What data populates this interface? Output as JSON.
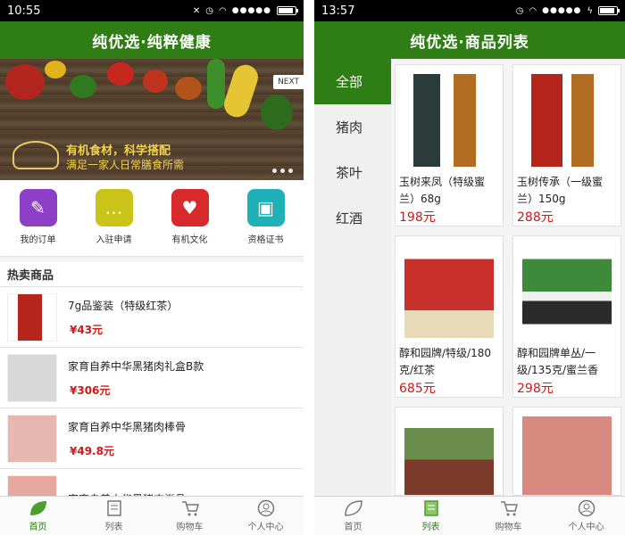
{
  "left": {
    "status": {
      "time": "10:55"
    },
    "header": {
      "title": "纯优选·纯粹健康"
    },
    "banner": {
      "next_label": "NEXT",
      "line1": "有机食材，科学搭配",
      "line2": "满足一家人日常膳食所需"
    },
    "quick": [
      {
        "label": "我的订单",
        "color": "#8e3fc8",
        "icon": "pencil-icon"
      },
      {
        "label": "入驻申请",
        "color": "#c9c417",
        "icon": "chat-icon"
      },
      {
        "label": "有机文化",
        "color": "#d82a2a",
        "icon": "heart-icon"
      },
      {
        "label": "资格证书",
        "color": "#1fb1b8",
        "icon": "id-card-icon"
      }
    ],
    "hot_title": "热卖商品",
    "hot_items": [
      {
        "name": "7g品鉴装（特级红茶）",
        "price": "¥43元"
      },
      {
        "name": "家育自养中华黑猪肉礼盒B款",
        "price": "¥306元"
      },
      {
        "name": "家育自养中华黑猪肉棒骨",
        "price": "¥49.8元"
      },
      {
        "name": "家育自养中华黑猪肉脊骨",
        "price": ""
      }
    ],
    "tabs": [
      {
        "label": "首页",
        "icon": "leaf-icon"
      },
      {
        "label": "列表",
        "icon": "list-icon"
      },
      {
        "label": "购物车",
        "icon": "cart-icon"
      },
      {
        "label": "个人中心",
        "icon": "user-icon"
      }
    ]
  },
  "right": {
    "status": {
      "time": "13:57"
    },
    "header": {
      "title": "纯优选·商品列表"
    },
    "categories": [
      "全部",
      "猪肉",
      "茶叶",
      "红酒"
    ],
    "products": [
      {
        "name": "玉树来凤（特级蜜兰）68g",
        "price": "198元"
      },
      {
        "name": "玉树传承（一级蜜兰）150g",
        "price": "288元"
      },
      {
        "name": "醇和园牌/特级/180克/红茶",
        "price": "685元"
      },
      {
        "name": "醇和园牌单丛/一级/135克/蜜兰香",
        "price": "298元"
      }
    ],
    "tabs": [
      {
        "label": "首页",
        "icon": "leaf-icon"
      },
      {
        "label": "列表",
        "icon": "list-icon"
      },
      {
        "label": "购物车",
        "icon": "cart-icon"
      },
      {
        "label": "个人中心",
        "icon": "user-icon"
      }
    ]
  },
  "colors": {
    "brand_green": "#2e7d15",
    "price_red": "#d01818"
  }
}
